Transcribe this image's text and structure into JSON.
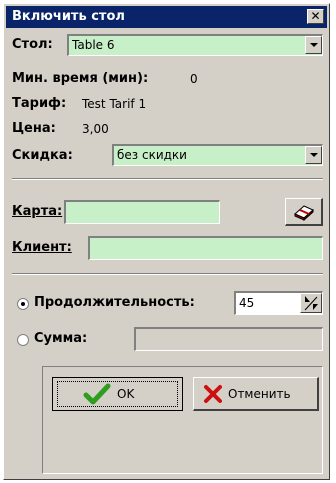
{
  "dialog": {
    "title": "Включить стол",
    "close_label": "✕"
  },
  "table": {
    "label": "Стол:",
    "value": "Table 6"
  },
  "min_time": {
    "label": "Мин. время (мин):",
    "value": "0"
  },
  "tariff": {
    "label": "Тариф:",
    "value": "Test Tarif 1"
  },
  "price": {
    "label": "Цена:",
    "value": "3,00"
  },
  "discount": {
    "label": "Скидка:",
    "value": "без скидки"
  },
  "card": {
    "label": "Карта:",
    "value": ""
  },
  "client": {
    "label": "Клиент:",
    "value": ""
  },
  "mode": {
    "duration_label": "Продолжительность:",
    "duration_value": "45",
    "duration_selected": true,
    "sum_label": "Сумма:",
    "sum_value": "",
    "sum_selected": false
  },
  "buttons": {
    "ok_label": "OK",
    "cancel_label": "Отменить"
  },
  "colors": {
    "titlebar": "#0a246a",
    "field_bg": "#c8f0c8",
    "face": "#d4d0c8",
    "ok_check": "#2e9e1e",
    "cancel_x": "#cc1010"
  }
}
